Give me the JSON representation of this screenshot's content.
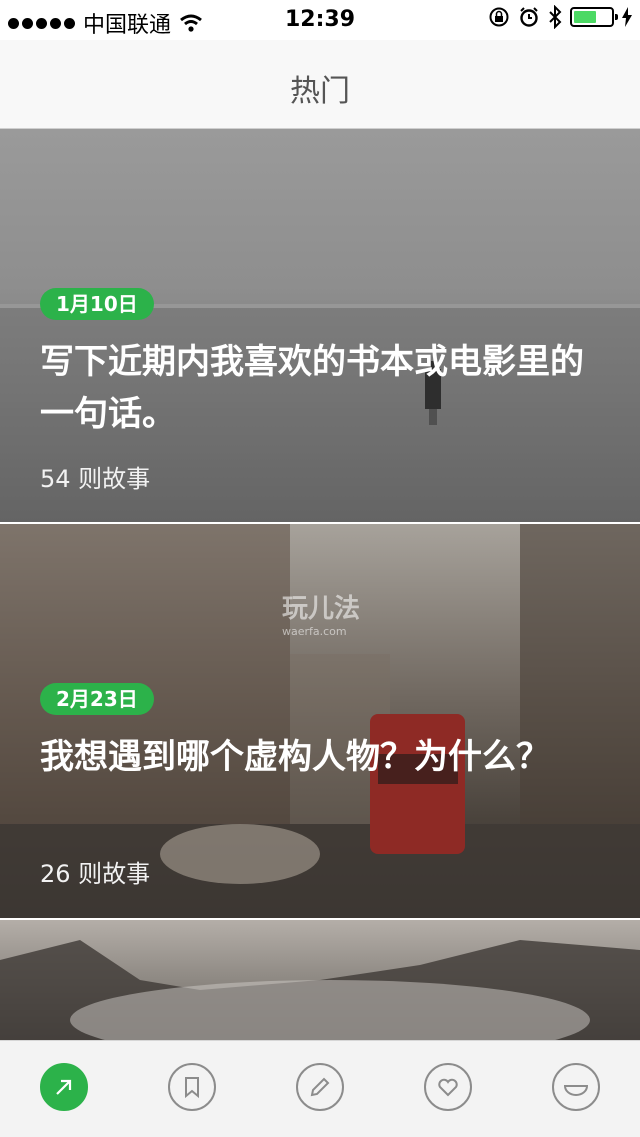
{
  "status_bar": {
    "carrier": "中国联通",
    "time": "12:39",
    "battery_level": 0.6
  },
  "nav": {
    "title": "热门"
  },
  "cards": [
    {
      "date": "1月10日",
      "title": "写下近期内我喜欢的书本或电影里的一句话。",
      "count": "54 则故事"
    },
    {
      "date": "2月23日",
      "title": "我想遇到哪个虚构人物？为什么？",
      "count": "26 则故事"
    }
  ],
  "watermark": {
    "main": "玩儿法",
    "sub": "waerfa.com"
  },
  "tabbar": {
    "tabs": [
      {
        "icon": "arrow-up-right-icon",
        "active": true
      },
      {
        "icon": "bookmark-icon",
        "active": false
      },
      {
        "icon": "pencil-icon",
        "active": false
      },
      {
        "icon": "heart-icon",
        "active": false
      },
      {
        "icon": "smile-icon",
        "active": false
      }
    ]
  },
  "colors": {
    "accent": "#2cb24a",
    "battery": "#4cd964"
  }
}
